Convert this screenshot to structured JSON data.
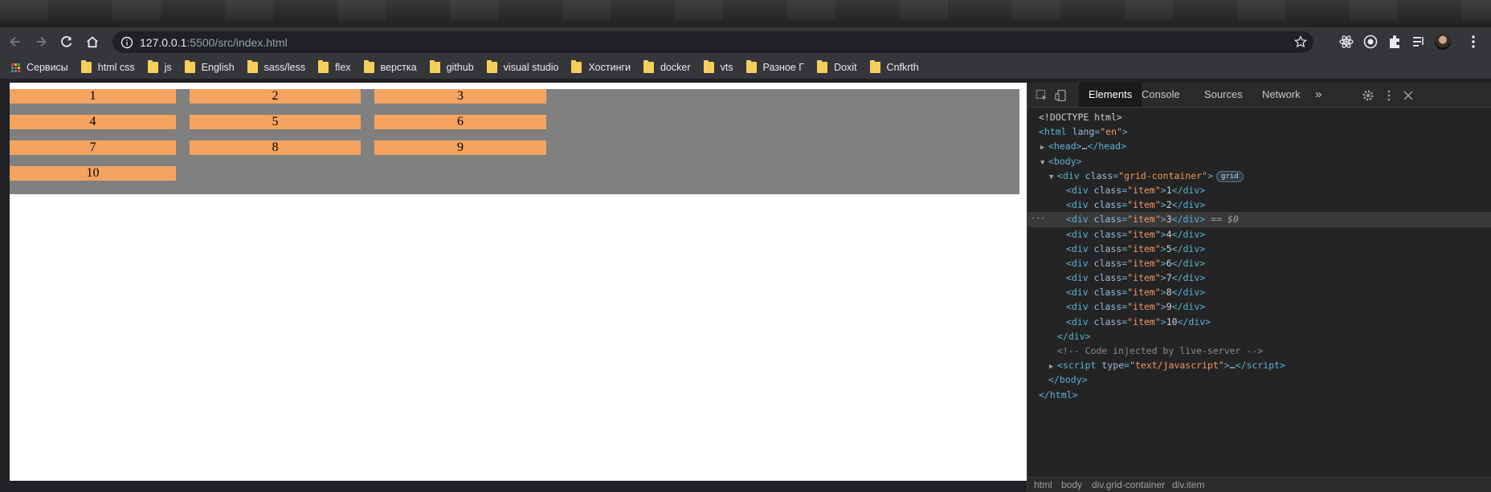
{
  "browser": {
    "url_host": "127.0.0.1",
    "url_rest": ":5500/src/index.html"
  },
  "bookmarks": {
    "apps_label": "Сервисы",
    "items": [
      "html css",
      "js",
      "English",
      "sass/less",
      "flex",
      "верстка",
      "github",
      "visual studio",
      "Хостинги",
      "docker",
      "vts",
      "Разное Г",
      "Doxit",
      "Cnfkrth"
    ]
  },
  "page": {
    "items": [
      "1",
      "2",
      "3",
      "4",
      "5",
      "6",
      "7",
      "8",
      "9",
      "10"
    ],
    "colors": {
      "container": "#808080",
      "item": "#f4a460"
    }
  },
  "devtools": {
    "tabs": [
      "Elements",
      "Console",
      "Sources",
      "Network"
    ],
    "more": "»",
    "selected_suffix": "== $0",
    "breadcrumb": [
      "html",
      "body",
      "div.grid-container",
      "div.item"
    ],
    "dom": {
      "doctype": "<!DOCTYPE html>",
      "html_open_tag": "html",
      "html_attr_name": "lang",
      "html_attr_value": "\"en\"",
      "head": "head",
      "ellipsis": "…",
      "body": "body",
      "div_tag": "div",
      "class_attr": "class",
      "container_class": "\"grid-container\"",
      "grid_badge": "grid",
      "item_class": "\"item\"",
      "comment": "<!-- Code injected by live-server -->",
      "script_tag": "script",
      "script_type_attr": "type",
      "script_type_value": "\"text/javascript\""
    }
  }
}
